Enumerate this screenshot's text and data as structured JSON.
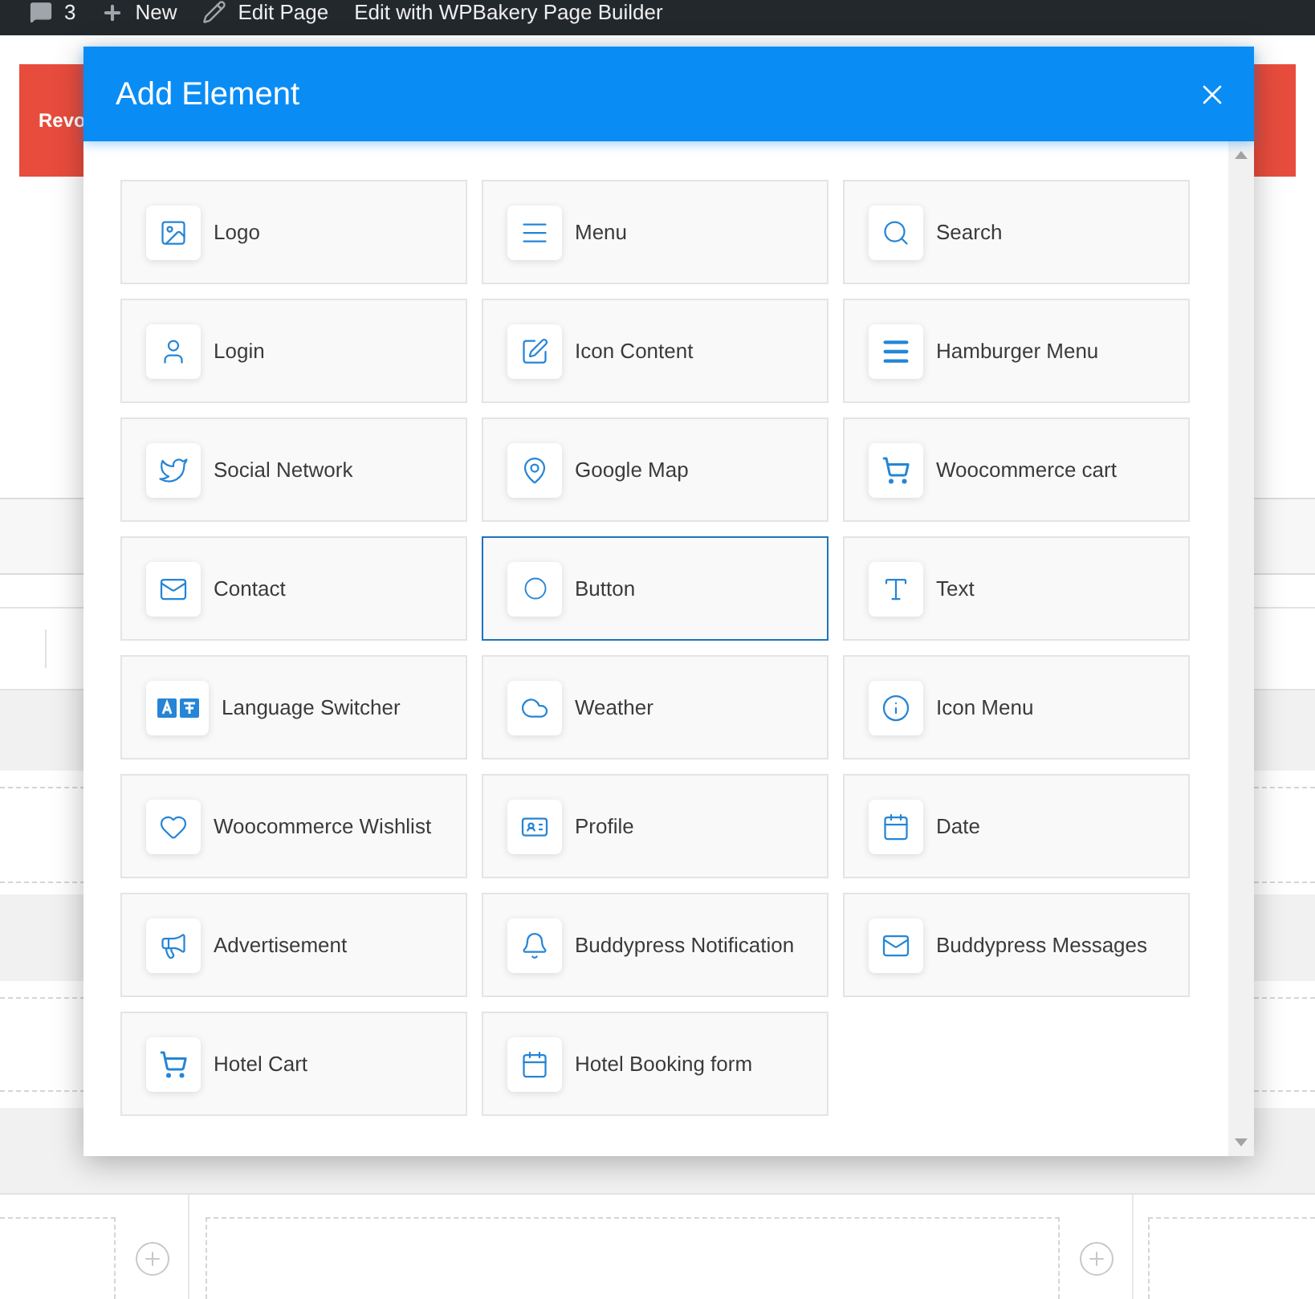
{
  "admin_bar": {
    "items": [
      {
        "kind": "comments",
        "label": "3"
      },
      {
        "kind": "new",
        "label": "New"
      },
      {
        "kind": "edit",
        "label": "Edit Page"
      },
      {
        "kind": "builder",
        "label": "Edit with WPBakery Page Builder"
      }
    ]
  },
  "page": {
    "banner": {
      "text": "Revo"
    }
  },
  "dialog": {
    "title": "Add Element",
    "elements": [
      {
        "label": "Logo",
        "kind": "image",
        "selected": false
      },
      {
        "label": "Menu",
        "kind": "lines",
        "selected": false
      },
      {
        "label": "Search",
        "kind": "search",
        "selected": false
      },
      {
        "label": "Login",
        "kind": "user",
        "selected": false
      },
      {
        "label": "Icon Content",
        "kind": "edit",
        "selected": false
      },
      {
        "label": "Hamburger Menu",
        "kind": "hamburger",
        "selected": false
      },
      {
        "label": "Social Network",
        "kind": "bird",
        "selected": false
      },
      {
        "label": "Google Map",
        "kind": "pin",
        "selected": false
      },
      {
        "label": "Woocommerce cart",
        "kind": "cart",
        "selected": false
      },
      {
        "label": "Contact",
        "kind": "envelope",
        "selected": false
      },
      {
        "label": "Button",
        "kind": "circle",
        "selected": true
      },
      {
        "label": "Text",
        "kind": "type",
        "selected": false
      },
      {
        "label": "Language Switcher",
        "kind": "language",
        "selected": false
      },
      {
        "label": "Weather",
        "kind": "cloud",
        "selected": false
      },
      {
        "label": "Icon Menu",
        "kind": "info",
        "selected": false
      },
      {
        "label": "Woocommerce Wishlist",
        "kind": "heart",
        "selected": false
      },
      {
        "label": "Profile",
        "kind": "idcard",
        "selected": false
      },
      {
        "label": "Date",
        "kind": "calendar",
        "selected": false
      },
      {
        "label": "Advertisement",
        "kind": "megaphone",
        "selected": false
      },
      {
        "label": "Buddypress Notification",
        "kind": "bell",
        "selected": false
      },
      {
        "label": "Buddypress Messages",
        "kind": "envelope",
        "selected": false
      },
      {
        "label": "Hotel Cart",
        "kind": "cart",
        "selected": false
      },
      {
        "label": "Hotel Booking form",
        "kind": "calendar",
        "selected": false
      }
    ]
  }
}
